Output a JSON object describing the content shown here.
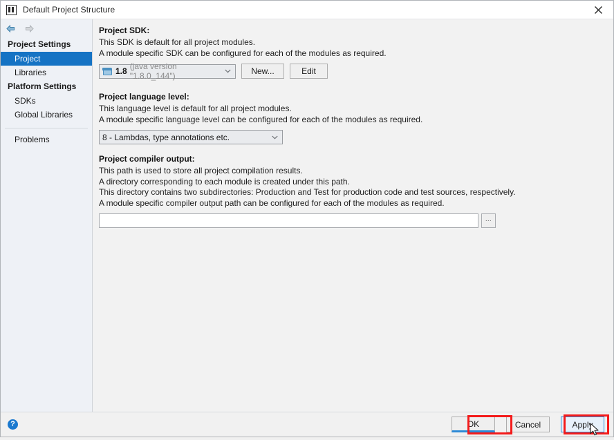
{
  "window": {
    "title": "Default Project Structure",
    "app_icon": "intellij-idea-icon",
    "close_icon": "close-icon"
  },
  "sidebar": {
    "back_icon": "arrow-left-icon",
    "forward_icon": "arrow-right-icon",
    "groups": [
      {
        "label": "Project Settings",
        "items": [
          {
            "label": "Project",
            "selected": true
          },
          {
            "label": "Libraries",
            "selected": false
          }
        ]
      },
      {
        "label": "Platform Settings",
        "items": [
          {
            "label": "SDKs",
            "selected": false
          },
          {
            "label": "Global Libraries",
            "selected": false
          }
        ]
      }
    ],
    "problems_label": "Problems"
  },
  "main": {
    "sdk_section": {
      "title": "Project SDK:",
      "line1": "This SDK is default for all project modules.",
      "line2": "A module specific SDK can be configured for each of the modules as required.",
      "combo": {
        "icon": "sdk-folder-icon",
        "version": "1.8",
        "detail": "(java version \"1.8.0_144\")",
        "chevron": "chevron-down-icon"
      },
      "new_button": "New...",
      "edit_button": "Edit"
    },
    "language_section": {
      "title": "Project language level:",
      "line1": "This language level is default for all project modules.",
      "line2": "A module specific language level can be configured for each of the modules as required.",
      "combo_value": "8 - Lambdas, type annotations etc.",
      "chevron": "chevron-down-icon"
    },
    "compiler_section": {
      "title": "Project compiler output:",
      "line1": "This path is used to store all project compilation results.",
      "line2": "A directory corresponding to each module is created under this path.",
      "line3": "This directory contains two subdirectories: Production and Test for production code and test sources, respectively.",
      "line4": "A module specific compiler output path can be configured for each of the modules as required.",
      "field_value": "",
      "field_placeholder": "",
      "browse_button": "..."
    }
  },
  "footer": {
    "help_label": "?",
    "ok_label": "OK",
    "cancel_label": "Cancel",
    "apply_label": "Apply"
  },
  "annotations": {
    "highlight_color": "#f41a1a",
    "targets": [
      "OK",
      "Apply"
    ]
  },
  "colors": {
    "accent_selection": "#1573c4",
    "default_button_underline": "#2d8ad6",
    "sidebar_bg": "#eef1f6",
    "content_bg": "#f2f2f2",
    "annotation_red": "#f41a1a"
  }
}
